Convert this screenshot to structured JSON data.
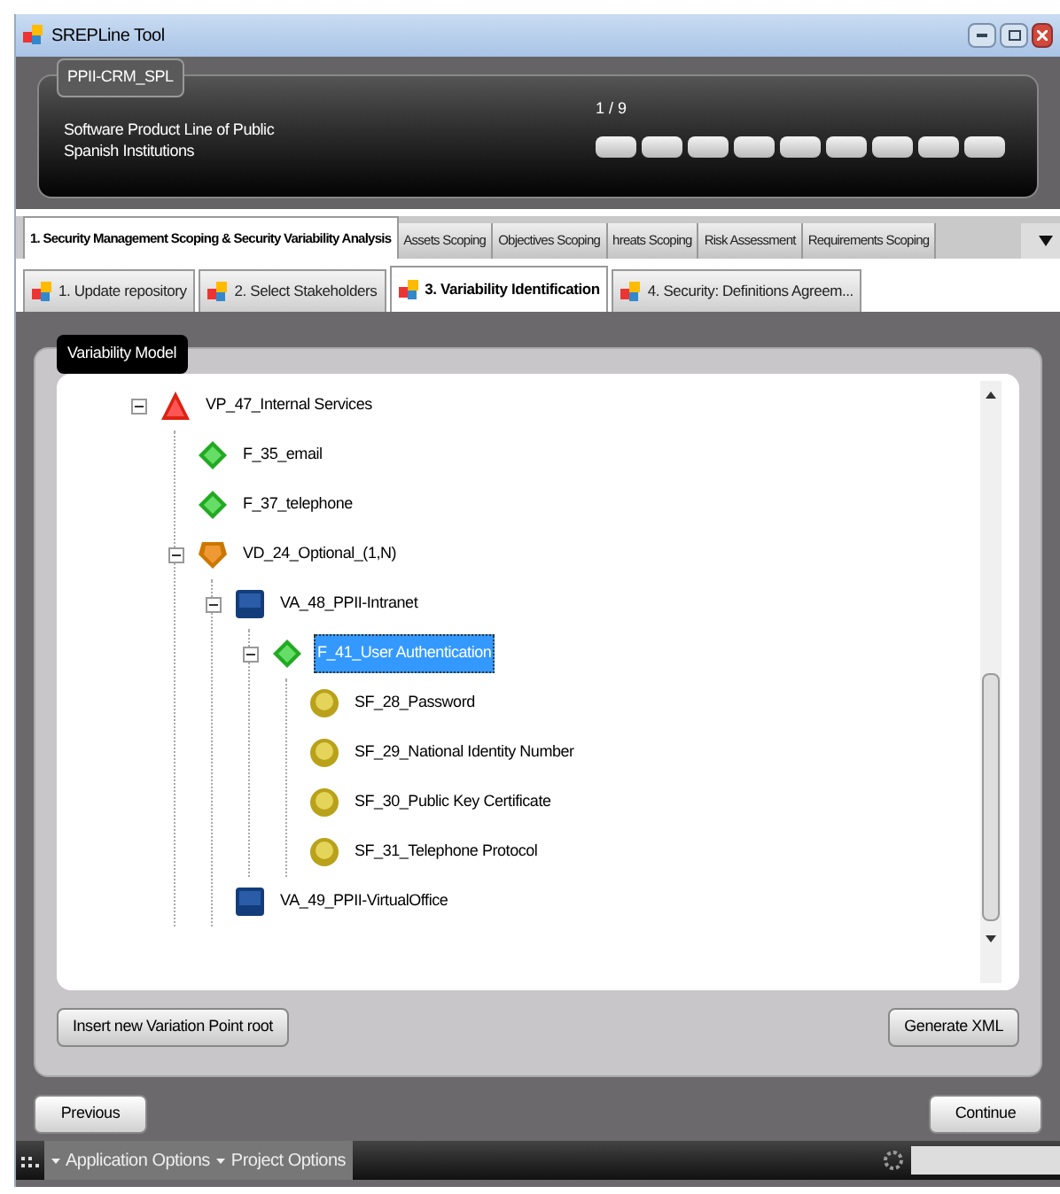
{
  "window": {
    "title": "SREPLine Tool"
  },
  "project": {
    "name": "PPII-CRM_SPL",
    "description": "Software Product Line of  Public Spanish Institutions",
    "progress": "1 / 9"
  },
  "main_tabs": [
    {
      "label": "1. Security Management Scoping & Security Variability Analysis",
      "selected": true
    },
    {
      "label": "Assets Scoping",
      "selected": false
    },
    {
      "label": "Objectives Scoping",
      "selected": false
    },
    {
      "label": "hreats Scoping",
      "selected": false
    },
    {
      "label": "Risk Assessment",
      "selected": false
    },
    {
      "label": "Requirements Scoping",
      "selected": false
    }
  ],
  "sub_tabs": [
    {
      "label": "1.  Update repository",
      "selected": false
    },
    {
      "label": "2. Select Stakeholders",
      "selected": false
    },
    {
      "label": "3. Variability Identification",
      "selected": true
    },
    {
      "label": "4.  Security:  Definitions  Agreem...",
      "selected": false
    }
  ],
  "group": {
    "title": "Variability Model"
  },
  "tree": [
    {
      "kind": "vp",
      "label": "VP_47_Internal Services",
      "expanded": true,
      "selected": false,
      "children": [
        {
          "kind": "feature",
          "label": "F_35_email",
          "selected": false
        },
        {
          "kind": "feature",
          "label": "F_37_telephone",
          "selected": false
        },
        {
          "kind": "vd",
          "label": "VD_24_Optional_(1,N)",
          "expanded": true,
          "selected": false,
          "children": [
            {
              "kind": "va",
              "label": "VA_48_PPII-Intranet",
              "expanded": true,
              "selected": false,
              "children": [
                {
                  "kind": "feature",
                  "label": "F_41_User Authentication",
                  "expanded": true,
                  "selected": true,
                  "children": [
                    {
                      "kind": "sf",
                      "label": "SF_28_Password",
                      "selected": false
                    },
                    {
                      "kind": "sf",
                      "label": "SF_29_National Identity Number",
                      "selected": false
                    },
                    {
                      "kind": "sf",
                      "label": "SF_30_Public Key Certificate",
                      "selected": false
                    },
                    {
                      "kind": "sf",
                      "label": "SF_31_Telephone Protocol",
                      "selected": false
                    }
                  ]
                }
              ]
            },
            {
              "kind": "va",
              "label": "VA_49_PPII-VirtualOffice",
              "selected": false
            }
          ]
        }
      ]
    }
  ],
  "group_buttons": [
    "Insert new Variation Point root",
    "Generate XML"
  ],
  "nav_buttons": [
    "Previous",
    "Continue"
  ],
  "bottom_menu": [
    "Application Options",
    "Project Options"
  ]
}
